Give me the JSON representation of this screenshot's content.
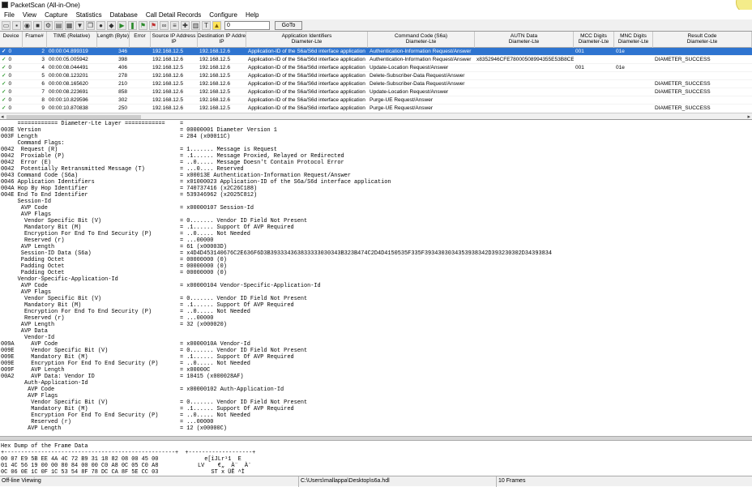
{
  "app": {
    "title": "PacketScan (All-in-One)"
  },
  "menu": [
    "File",
    "View",
    "Capture",
    "Statistics",
    "Database",
    "Call Detail Records",
    "Configure",
    "Help"
  ],
  "toolbar": {
    "icons": [
      "open-icon",
      "save-icon",
      "capture-icon",
      "stop-icon",
      "settings-icon",
      "print-icon",
      "grid-icon",
      "filter-icon",
      "copy-icon",
      "record-icon",
      "marker-icon",
      "play-green-icon",
      "pause-green-icon",
      "flag-green-icon",
      "flag-red-icon",
      "link-icon",
      "list-icon",
      "tools-icon",
      "stats-icon",
      "text-icon",
      "chart-yellow-icon"
    ],
    "goto_value": "0",
    "goto_label": "GoTo"
  },
  "table": {
    "columns": [
      "Device",
      "Frame#",
      "TIME (Relative)",
      "Length (Byte)",
      "Error",
      "Source IP Address\nIP",
      "Destination IP Address\nIP",
      "Application Identifiers\nDiameter-Lte",
      "Command Code (S6a)\nDiameter-Lte",
      "AUTN Data\nDiameter-Lte",
      "MCC Digits\nDiameter-Lte",
      "MNC Digits\nDiameter-Lte",
      "Result Code\nDiameter-Lte"
    ],
    "rows": [
      {
        "device": "0",
        "frame": "2",
        "time": "00:00:04.899319",
        "length": "346",
        "error": "",
        "src": "192.168.12.5",
        "dst": "192.168.12.6",
        "app": "Application-ID of the S6a/S6d interface application",
        "cmd": "Authentication-Information Request/Answer",
        "autn": "",
        "mcc": "001",
        "mnc": "01e",
        "result": "",
        "selected": true
      },
      {
        "device": "0",
        "frame": "3",
        "time": "00:00:05.005942",
        "length": "398",
        "error": "",
        "src": "192.168.12.6",
        "dst": "192.168.12.5",
        "app": "Application-ID of the S6a/S6d interface application",
        "cmd": "Authentication-Information Request/Answer",
        "autn": "x8352946CFE78000508994355E53B8CE",
        "mcc": "",
        "mnc": "",
        "result": "DIAMETER_SUCCESS",
        "selected": false
      },
      {
        "device": "0",
        "frame": "4",
        "time": "00:00:08.044491",
        "length": "406",
        "error": "",
        "src": "192.168.12.5",
        "dst": "192.168.12.6",
        "app": "Application-ID of the S6a/S6d interface application",
        "cmd": "Update-Location Request/Answer",
        "autn": "",
        "mcc": "001",
        "mnc": "01e",
        "result": "",
        "selected": false
      },
      {
        "device": "0",
        "frame": "5",
        "time": "00:00:08.123201",
        "length": "278",
        "error": "",
        "src": "192.168.12.6",
        "dst": "192.168.12.5",
        "app": "Application-ID of the S6a/S6d interface application",
        "cmd": "Delete-Subscriber-Data Request/Answer",
        "autn": "",
        "mcc": "",
        "mnc": "",
        "result": "",
        "selected": false
      },
      {
        "device": "0",
        "frame": "6",
        "time": "00:00:08.165620",
        "length": "210",
        "error": "",
        "src": "192.168.12.5",
        "dst": "192.168.12.6",
        "app": "Application-ID of the S6a/S6d interface application",
        "cmd": "Delete-Subscriber-Data Request/Answer",
        "autn": "",
        "mcc": "",
        "mnc": "",
        "result": "DIAMETER_SUCCESS",
        "selected": false
      },
      {
        "device": "0",
        "frame": "7",
        "time": "00:00:08.223691",
        "length": "858",
        "error": "",
        "src": "192.168.12.6",
        "dst": "192.168.12.5",
        "app": "Application-ID of the S6a/S6d interface application",
        "cmd": "Update-Location Request/Answer",
        "autn": "",
        "mcc": "",
        "mnc": "",
        "result": "DIAMETER_SUCCESS",
        "selected": false
      },
      {
        "device": "0",
        "frame": "8",
        "time": "00:00:10.829596",
        "length": "302",
        "error": "",
        "src": "192.168.12.5",
        "dst": "192.168.12.6",
        "app": "Application-ID of the S6a/S6d interface application",
        "cmd": "Purge-UE Request/Answer",
        "autn": "",
        "mcc": "",
        "mnc": "",
        "result": "",
        "selected": false
      },
      {
        "device": "0",
        "frame": "9",
        "time": "00:00:10.870838",
        "length": "250",
        "error": "",
        "src": "192.168.12.6",
        "dst": "192.168.12.5",
        "app": "Application-ID of the S6a/S6d interface application",
        "cmd": "Purge-UE Request/Answer",
        "autn": "",
        "mcc": "",
        "mnc": "",
        "result": "DIAMETER_SUCCESS",
        "selected": false
      }
    ]
  },
  "detail": {
    "lines": [
      {
        "l": "     ============ Diameter-Lte Layer ============",
        "r": "="
      },
      {
        "l": "003E Version",
        "r": "= 00000001 Diameter Version 1"
      },
      {
        "l": "003F Length",
        "r": "= 284 (x00011C)"
      },
      {
        "l": "     Command Flags:",
        "r": ""
      },
      {
        "l": "0042  Request (R)",
        "r": "= 1....... Message is Request"
      },
      {
        "l": "0042  Proxiable (P)",
        "r": "= .1...... Message Proxied, Relayed or Redirected"
      },
      {
        "l": "0042  Error (E)",
        "r": "= ..0..... Message Doesn't Contain Protocol Error"
      },
      {
        "l": "0042  Potentially Retransmitted Message (T)",
        "r": "= ...0.... Reserved"
      },
      {
        "l": "0043 Command Code (S6a)",
        "r": "= x00013E Authentication-Information Request/Answer"
      },
      {
        "l": "0046 Application Identifiers",
        "r": "= x01000023 Application-ID of the S6a/S6d interface application"
      },
      {
        "l": "004A Hop By Hop Identifier",
        "r": "= 740737416 (x2C26C188)"
      },
      {
        "l": "004E End To End Identifier",
        "r": "= 539346962 (x2025C812)"
      },
      {
        "l": "     Session-Id",
        "r": ""
      },
      {
        "l": "      AVP Code",
        "r": "= x00000107 Session-Id"
      },
      {
        "l": "      AVP Flags",
        "r": ""
      },
      {
        "l": "       Vendor Specific Bit (V)",
        "r": "= 0....... Vendor ID Field Not Present"
      },
      {
        "l": "       Mandatory Bit (M)",
        "r": "= .1...... Support Of AVP Required"
      },
      {
        "l": "       Encryption For End To End Security (P)",
        "r": "= ..0..... Not Needed"
      },
      {
        "l": "       Reserved (r)",
        "r": "= ...00000"
      },
      {
        "l": "      AVP Length",
        "r": "= 61 (x00003D)"
      },
      {
        "l": "      Session-ID Data (S6a)",
        "r": "= x4D4D453140676C2E636F6D3B393334363833333030343B323B474C2D4D4150535F335F3934303034353938342D393230302D34393834"
      },
      {
        "l": "      Padding Octet",
        "r": "= 00000000 (0)"
      },
      {
        "l": "      Padding Octet",
        "r": "= 00000000 (0)"
      },
      {
        "l": "      Padding Octet",
        "r": "= 00000000 (0)"
      },
      {
        "l": "     Vendor-Specific-Application-Id",
        "r": ""
      },
      {
        "l": "      AVP Code",
        "r": "= x00000104 Vendor-Specific-Application-Id"
      },
      {
        "l": "      AVP Flags",
        "r": ""
      },
      {
        "l": "       Vendor Specific Bit (V)",
        "r": "= 0....... Vendor ID Field Not Present"
      },
      {
        "l": "       Mandatory Bit (M)",
        "r": "= .1...... Support Of AVP Required"
      },
      {
        "l": "       Encryption For End To End Security (P)",
        "r": "= ..0..... Not Needed"
      },
      {
        "l": "       Reserved (r)",
        "r": "= ...00000"
      },
      {
        "l": "      AVP Length",
        "r": "= 32 (x000020)"
      },
      {
        "l": "      AVP Data",
        "r": ""
      },
      {
        "l": "       Vendor-Id",
        "r": ""
      },
      {
        "l": "009A     AVP Code",
        "r": "= x0000010A Vendor-Id"
      },
      {
        "l": "009E     Vendor Specific Bit (V)",
        "r": "= 0....... Vendor ID Field Not Present"
      },
      {
        "l": "009E     Mandatory Bit (M)",
        "r": "= .1...... Support Of AVP Required"
      },
      {
        "l": "009E     Encryption For End To End Security (P)",
        "r": "= ..0..... Not Needed"
      },
      {
        "l": "009F     AVP Length",
        "r": "= x00000C"
      },
      {
        "l": "00A2     AVP Data: Vendor ID",
        "r": "= 10415 (x000028AF)"
      },
      {
        "l": "       Auth-Application-Id",
        "r": ""
      },
      {
        "l": "        AVP Code",
        "r": "= x00000102 Auth-Application-Id"
      },
      {
        "l": "        AVP Flags",
        "r": ""
      },
      {
        "l": "         Vendor Specific Bit (V)",
        "r": "= 0....... Vendor ID Field Not Present"
      },
      {
        "l": "         Mandatory Bit (M)",
        "r": "= .1...... Support Of AVP Required"
      },
      {
        "l": "         Encryption For End To End Security (P)",
        "r": "= ..0..... Not Needed"
      },
      {
        "l": "         Reserved (r)",
        "r": "= ...00000"
      },
      {
        "l": "        AVP Length",
        "r": "= 12 (x00000C)"
      }
    ]
  },
  "hex": {
    "title": "Hex Dump of the Frame Data",
    "rule": "+---------------------------------------------------+  +-------------------+",
    "lines": [
      {
        "h": "00 07 E9 5B EE 4A 4C 72 B9 31 18 82 08 00 45 00",
        "a": "  e[îJLr¹1  E"
      },
      {
        "h": "01 4C 56 19 00 00 80 84 00 00 C0 A8 0C 05 C0 A8",
        "a": "LV    €„  À¨  À¨"
      },
      {
        "h": "0C 06 0E 1C 0F 1C 53 54 8F 78 DC CA 8F 5E CC 03",
        "a": "    ST x ÜÊ ^Ì"
      }
    ]
  },
  "status": {
    "mode": "Off-line Viewing",
    "file": "C:\\Users\\mallappa\\Desktop\\s6a.hdl",
    "frames": "10 Frames"
  }
}
